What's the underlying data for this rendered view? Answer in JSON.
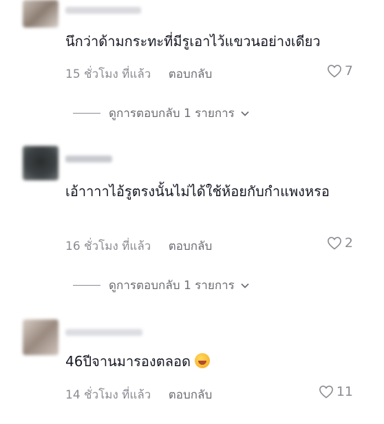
{
  "comments": [
    {
      "text": "นึกว่าด้ามกระทะที่มีรูเอาไว้แขวนอย่างเดียว",
      "time": "15 ชั่วโมง ที่แล้ว",
      "reply_label": "ตอบกลับ",
      "likes": "7",
      "view_replies": "ดูการตอบกลับ 1 รายการ"
    },
    {
      "text": "เอ้าาาาไอ้รูตรงนั้นไม่ได้ใช้ห้อยกับกำแพงหรอ",
      "time": "16 ชั่วโมง ที่แล้ว",
      "reply_label": "ตอบกลับ",
      "likes": "2",
      "view_replies": "ดูการตอบกลับ 1 รายการ"
    },
    {
      "text": "46ปีจานมารองตลอด",
      "emoji": "sweat-smile-emoji",
      "time": "14 ชั่วโมง ที่แล้ว",
      "reply_label": "ตอบกลับ",
      "likes": "11"
    }
  ],
  "icons": {
    "like": "heart-outline-icon",
    "expand": "chevron-down-icon"
  }
}
